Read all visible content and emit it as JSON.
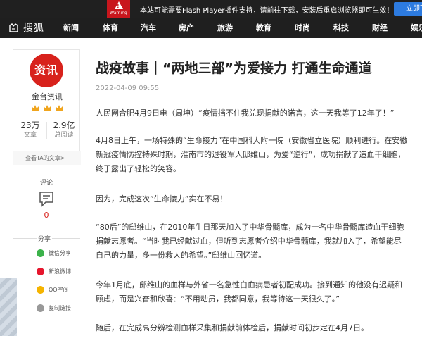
{
  "warning": {
    "badge_label": "Warning",
    "text": "本站可能需要Flash Player插件支持，请前往下载，安装后重启浏览器即可生效！",
    "button_label": "立即下"
  },
  "header": {
    "logo_text": "搜狐",
    "nav": [
      "新闻",
      "体育",
      "汽车",
      "房产",
      "旅游",
      "教育",
      "时尚",
      "科技",
      "财经",
      "娱乐"
    ]
  },
  "author": {
    "avatar_text": "资讯",
    "name": "金台资讯",
    "articles_count": "23万",
    "articles_label": "文章",
    "reads_count": "2.9亿",
    "reads_label": "总阅读",
    "view_link": "查看TA的文章>"
  },
  "comments": {
    "label": "评论",
    "count": "0"
  },
  "share": {
    "label": "分享",
    "items": [
      {
        "label": "微信分享",
        "color": "#3bb24a"
      },
      {
        "label": "新浪微博",
        "color": "#e6162d"
      },
      {
        "label": "QQ空间",
        "color": "#f5b400"
      },
      {
        "label": "复制链接",
        "color": "#999999"
      }
    ]
  },
  "article": {
    "title": "战疫故事｜“两地三部”为爱接力 打通生命通道",
    "time": "2022-04-09 09:55",
    "paragraphs": [
      "人民网合肥4月9日电（周坤）“疫情挡不住我兑现捐献的诺言，这一天我等了12年了！”",
      "4月8日上午，一场特殊的“生命接力”在中国科大附一院（安徽省立医院）顺利进行。在安徽新冠疫情防控特殊时期，淮南市的退役军人邸维山，为爱“逆行”，成功捐献了造血干细胞，终于露出了轻松的笑容。",
      "因为，完成这次“生命接力”实在不易！",
      "“80后”的邸维山，在2010年生日那天加入了中华骨髓库，成为一名中华骨髓库造血干细胞捐献志愿者。“当时我已经献过血，但听到志愿者介绍中华骨髓库，我就加入了，希望能尽自己的力量，多一份救人的希望。”邸维山回忆道。",
      "今年1月底，邸维山的血样与外省一名急性白血病患者初配成功。接到通知的他没有迟疑和顾虑，而是兴奋和欣喜：“不用动员，我都同意，我等待这一天很久了。”",
      "随后，在完成高分辨检测血样采集和捐献前体检后，捐献时间初步定在4月7日。"
    ]
  }
}
